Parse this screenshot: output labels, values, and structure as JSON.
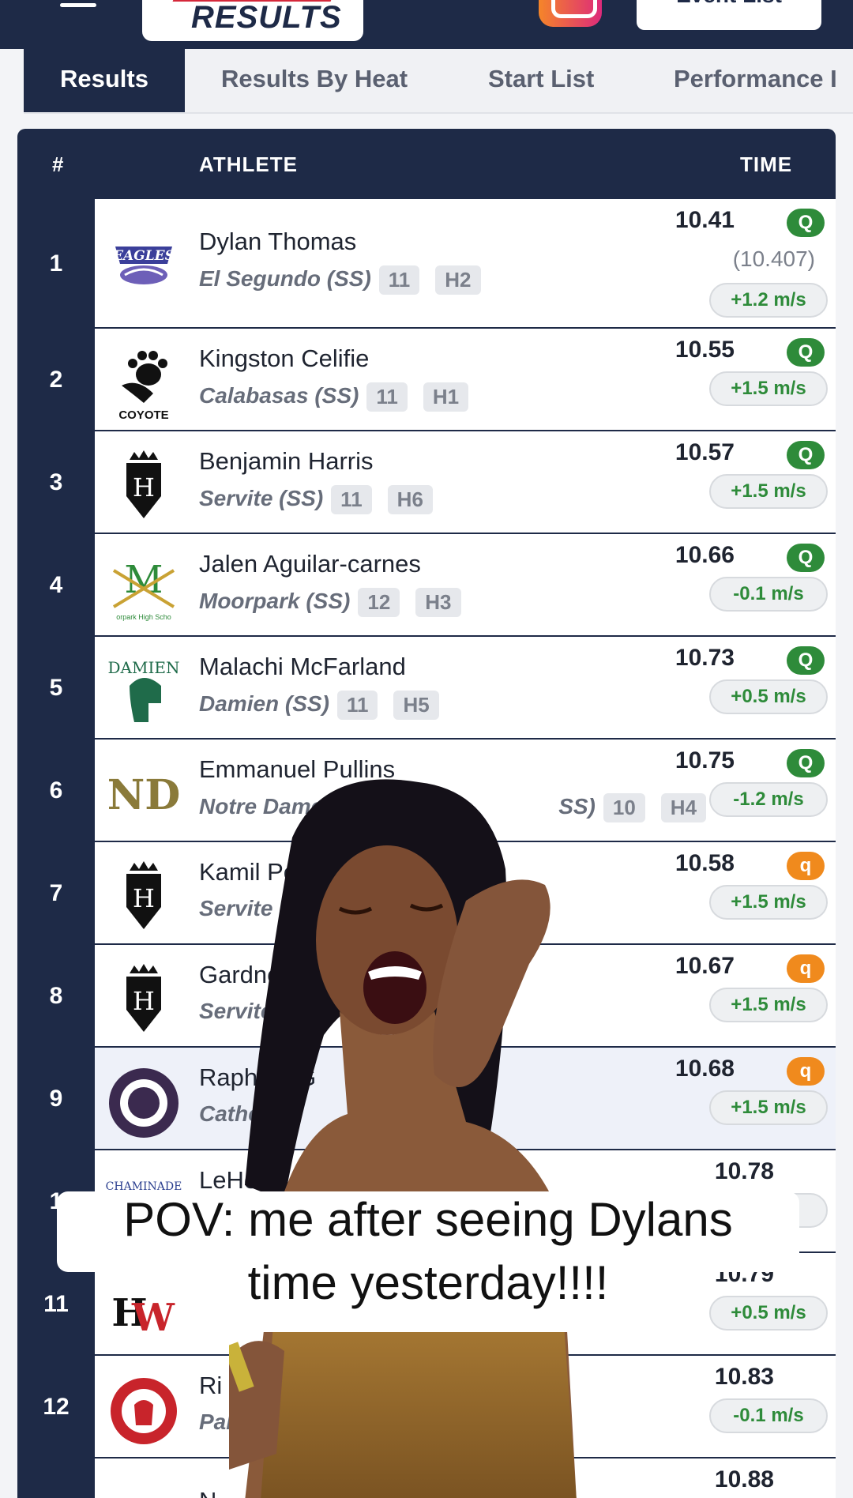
{
  "header": {
    "logo_text": "RESULTS",
    "event_list_label": "Event List",
    "menu_icon": "hamburger-icon",
    "social_icon": "instagram-icon"
  },
  "tabs": [
    {
      "label": "Results",
      "active": true
    },
    {
      "label": "Results By Heat"
    },
    {
      "label": "Start List"
    },
    {
      "label": "Performance I"
    }
  ],
  "table": {
    "col_rank": "#",
    "col_athlete": "ATHLETE",
    "col_time": "TIME",
    "rows": [
      {
        "rank": "1",
        "name": "Dylan Thomas",
        "school": "El Segundo (SS)",
        "grade": "11",
        "heat": "H2",
        "time": "10.41",
        "q": "Q",
        "precise": "(10.407)",
        "wind": "+1.2 m/s",
        "logo": "eagles-logo"
      },
      {
        "rank": "2",
        "name": "Kingston Celifie",
        "school": "Calabasas (SS)",
        "grade": "11",
        "heat": "H1",
        "time": "10.55",
        "q": "Q",
        "wind": "+1.5 m/s",
        "logo": "coyote-logo"
      },
      {
        "rank": "3",
        "name": "Benjamin Harris",
        "school": "Servite (SS)",
        "grade": "11",
        "heat": "H6",
        "time": "10.57",
        "q": "Q",
        "wind": "+1.5 m/s",
        "logo": "servite-logo"
      },
      {
        "rank": "4",
        "name": "Jalen Aguilar-carnes",
        "school": "Moorpark (SS)",
        "grade": "12",
        "heat": "H3",
        "time": "10.66",
        "q": "Q",
        "wind": "-0.1 m/s",
        "logo": "moorpark-logo"
      },
      {
        "rank": "5",
        "name": "Malachi McFarland",
        "school": "Damien (SS)",
        "grade": "11",
        "heat": "H5",
        "time": "10.73",
        "q": "Q",
        "wind": "+0.5 m/s",
        "logo": "damien-logo"
      },
      {
        "rank": "6",
        "name": "Emmanuel Pullins",
        "school": "Notre Dame - Sherr",
        "school_tail": "SS)",
        "grade": "10",
        "heat": "H4",
        "time": "10.75",
        "q": "Q",
        "wind": "-1.2 m/s",
        "logo": "notre-dame-logo"
      },
      {
        "rank": "7",
        "name": "Kamil Pelove",
        "school": "Servite (SS)",
        "time": "10.58",
        "q": "q",
        "wind": "+1.5 m/s",
        "logo": "servite-logo"
      },
      {
        "rank": "8",
        "name": "Gardner Rob",
        "school": "Servite (SS)",
        "time": "10.67",
        "q": "q",
        "wind": "+1.5 m/s",
        "logo": "servite-logo"
      },
      {
        "rank": "9",
        "name": "Raphael G",
        "school": "Cathedral",
        "time": "10.68",
        "q": "q",
        "wind": "+1.5 m/s",
        "logo": "cathedral-logo",
        "highlight": true
      },
      {
        "rank": "1",
        "name": "LeHe",
        "school": "",
        "time": "10.78",
        "wind": "s",
        "logo": "chaminade-logo"
      },
      {
        "rank": "11",
        "name": "",
        "school": "",
        "time": "10.79",
        "wind": "+0.5 m/s",
        "logo": "hw-logo"
      },
      {
        "rank": "12",
        "name": "Ri",
        "school": "Palos",
        "time": "10.83",
        "wind": "-0.1 m/s",
        "logo": "palos-verdes-logo"
      },
      {
        "rank": "",
        "name": "N",
        "school": "",
        "time": "10.88",
        "logo": ""
      }
    ]
  },
  "caption": {
    "line1": "POV: me after seeing Dylans",
    "line2": "time yesterday!!!!"
  },
  "colors": {
    "navy": "#1e2a47",
    "qualified": "#2e8b3a",
    "qualified_time": "#f08a1d"
  }
}
